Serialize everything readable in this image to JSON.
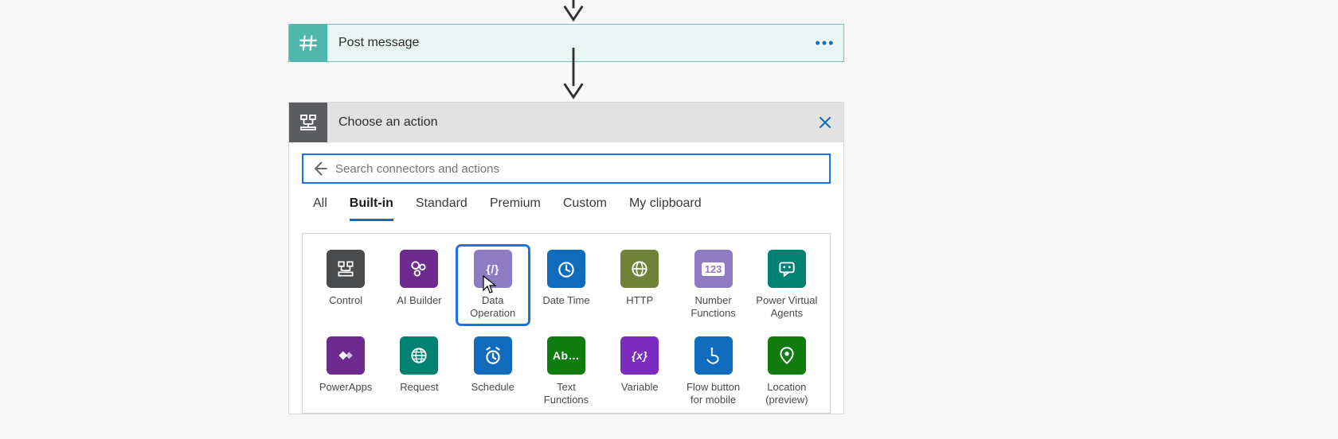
{
  "post_message": {
    "title": "Post message",
    "menu_label": "•••"
  },
  "panel": {
    "title": "Choose an action",
    "close_label": "×",
    "search_placeholder": "Search connectors and actions",
    "tabs": [
      "All",
      "Built-in",
      "Standard",
      "Premium",
      "Custom",
      "My clipboard"
    ],
    "active_tab": "Built-in",
    "connectors": [
      {
        "label": "Control",
        "icon": "control",
        "color": "bg-dark"
      },
      {
        "label": "AI Builder",
        "icon": "aibuilder",
        "color": "bg-purp1"
      },
      {
        "label": "Data\nOperation",
        "icon": "dataop",
        "color": "bg-lav",
        "selected": true
      },
      {
        "label": "Date Time",
        "icon": "clock",
        "color": "bg-blue"
      },
      {
        "label": "HTTP",
        "icon": "http",
        "color": "bg-olive"
      },
      {
        "label": "Number\nFunctions",
        "icon": "num",
        "color": "bg-lav2"
      },
      {
        "label": "Power Virtual\nAgents",
        "icon": "pva",
        "color": "bg-teal"
      },
      {
        "label": "PowerApps",
        "icon": "papps",
        "color": "bg-purp2"
      },
      {
        "label": "Request",
        "icon": "request",
        "color": "bg-teal2"
      },
      {
        "label": "Schedule",
        "icon": "alarm",
        "color": "bg-blue2"
      },
      {
        "label": "Text\nFunctions",
        "icon": "text",
        "color": "bg-green"
      },
      {
        "label": "Variable",
        "icon": "var",
        "color": "bg-vpurp"
      },
      {
        "label": "Flow button\nfor mobile",
        "icon": "touch",
        "color": "bg-blue3"
      },
      {
        "label": "Location\n(preview)",
        "icon": "pin",
        "color": "bg-green2"
      }
    ]
  },
  "icons": {
    "num": "123",
    "text": "Ab…",
    "var": "{x}",
    "dataop": "{/}"
  }
}
